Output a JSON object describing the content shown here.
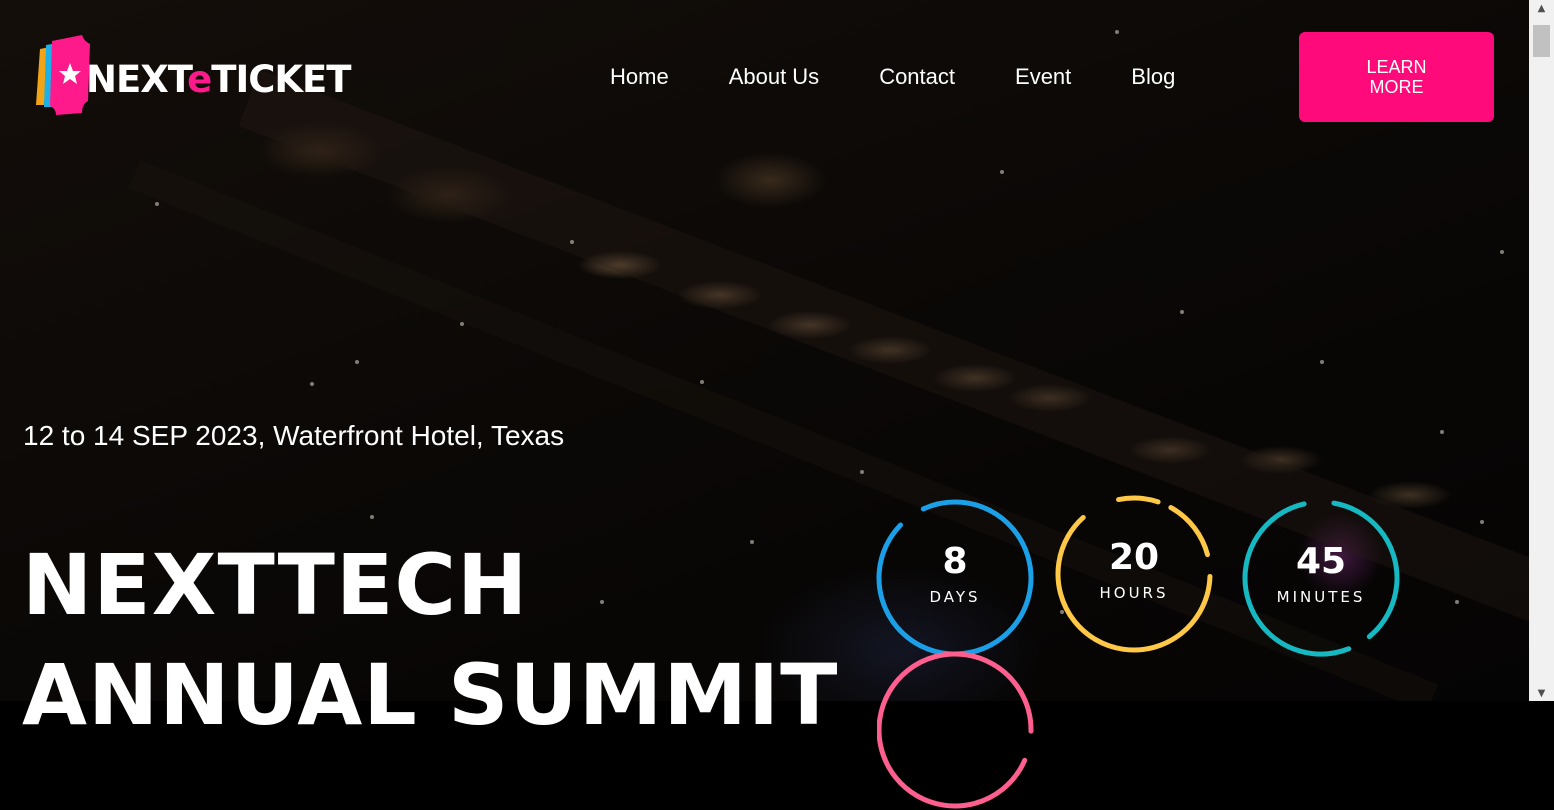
{
  "brand": {
    "logo_prefix": "NEXT",
    "logo_accent": "e",
    "logo_suffix": "TICKET",
    "accent_color": "#ff0a7a"
  },
  "nav": {
    "items": [
      {
        "label": "Home"
      },
      {
        "label": "About Us"
      },
      {
        "label": "Contact"
      },
      {
        "label": "Event"
      },
      {
        "label": "Blog"
      }
    ]
  },
  "cta": {
    "label": "LEARN MORE"
  },
  "event": {
    "meta": "12 to 14 SEP 2023, Waterfront Hotel, Texas",
    "title_line1": "NEXTTECH",
    "title_line2": "ANNUAL SUMMIT"
  },
  "countdown": [
    {
      "value": "8",
      "label": "DAYS",
      "color": "#1ba0e8"
    },
    {
      "value": "20",
      "label": "HOURS",
      "color": "#ffc847"
    },
    {
      "value": "45",
      "label": "MINUTES",
      "color": "#16b8c2"
    },
    {
      "value": "",
      "label": "",
      "color": "#ff5f8f"
    }
  ],
  "icons": {
    "scroll_up": "▲",
    "scroll_down": "▼"
  }
}
